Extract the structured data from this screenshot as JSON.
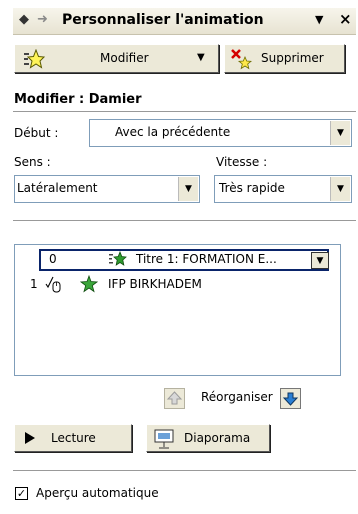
{
  "titlebar": {
    "back_icon": "◆",
    "forward_icon": "➜",
    "title": "Personnaliser l'animation",
    "menu_icon": "▼",
    "close_icon": "×"
  },
  "toolbar": {
    "modify_label": "Modifier",
    "modify_arrow": "▼",
    "delete_label": "Supprimer"
  },
  "section": {
    "title": "Modifier : Damier"
  },
  "start": {
    "label": "Début :",
    "value": "Avec la précédente",
    "arrow": "▼"
  },
  "direction": {
    "label": "Sens :",
    "value": "Latéralement",
    "arrow": "▼"
  },
  "speed": {
    "label": "Vitesse :",
    "value": "Très rapide",
    "arrow": "▼"
  },
  "animations": [
    {
      "order": "0",
      "name": "Titre 1: FORMATION E...",
      "dropdown": "▼"
    },
    {
      "order": "1",
      "name": "IFP BIRKHADEM"
    }
  ],
  "reorder": {
    "label": "Réorganiser"
  },
  "buttons": {
    "play_label": "Lecture",
    "slideshow_label": "Diaporama"
  },
  "autopreview": {
    "label": "Aperçu automatique",
    "checked": true,
    "mark": "✓"
  }
}
